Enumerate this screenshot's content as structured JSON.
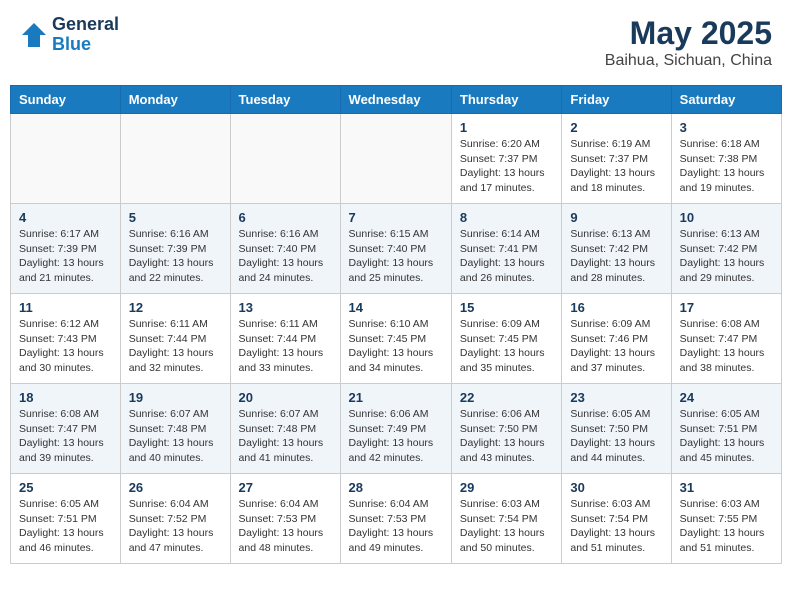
{
  "header": {
    "logo_line1": "General",
    "logo_line2": "Blue",
    "main_title": "May 2025",
    "subtitle": "Baihua, Sichuan, China"
  },
  "weekdays": [
    "Sunday",
    "Monday",
    "Tuesday",
    "Wednesday",
    "Thursday",
    "Friday",
    "Saturday"
  ],
  "weeks": [
    [
      {
        "day": "",
        "sunrise": "",
        "sunset": "",
        "daylight": ""
      },
      {
        "day": "",
        "sunrise": "",
        "sunset": "",
        "daylight": ""
      },
      {
        "day": "",
        "sunrise": "",
        "sunset": "",
        "daylight": ""
      },
      {
        "day": "",
        "sunrise": "",
        "sunset": "",
        "daylight": ""
      },
      {
        "day": "1",
        "sunrise": "Sunrise: 6:20 AM",
        "sunset": "Sunset: 7:37 PM",
        "daylight": "Daylight: 13 hours and 17 minutes."
      },
      {
        "day": "2",
        "sunrise": "Sunrise: 6:19 AM",
        "sunset": "Sunset: 7:37 PM",
        "daylight": "Daylight: 13 hours and 18 minutes."
      },
      {
        "day": "3",
        "sunrise": "Sunrise: 6:18 AM",
        "sunset": "Sunset: 7:38 PM",
        "daylight": "Daylight: 13 hours and 19 minutes."
      }
    ],
    [
      {
        "day": "4",
        "sunrise": "Sunrise: 6:17 AM",
        "sunset": "Sunset: 7:39 PM",
        "daylight": "Daylight: 13 hours and 21 minutes."
      },
      {
        "day": "5",
        "sunrise": "Sunrise: 6:16 AM",
        "sunset": "Sunset: 7:39 PM",
        "daylight": "Daylight: 13 hours and 22 minutes."
      },
      {
        "day": "6",
        "sunrise": "Sunrise: 6:16 AM",
        "sunset": "Sunset: 7:40 PM",
        "daylight": "Daylight: 13 hours and 24 minutes."
      },
      {
        "day": "7",
        "sunrise": "Sunrise: 6:15 AM",
        "sunset": "Sunset: 7:40 PM",
        "daylight": "Daylight: 13 hours and 25 minutes."
      },
      {
        "day": "8",
        "sunrise": "Sunrise: 6:14 AM",
        "sunset": "Sunset: 7:41 PM",
        "daylight": "Daylight: 13 hours and 26 minutes."
      },
      {
        "day": "9",
        "sunrise": "Sunrise: 6:13 AM",
        "sunset": "Sunset: 7:42 PM",
        "daylight": "Daylight: 13 hours and 28 minutes."
      },
      {
        "day": "10",
        "sunrise": "Sunrise: 6:13 AM",
        "sunset": "Sunset: 7:42 PM",
        "daylight": "Daylight: 13 hours and 29 minutes."
      }
    ],
    [
      {
        "day": "11",
        "sunrise": "Sunrise: 6:12 AM",
        "sunset": "Sunset: 7:43 PM",
        "daylight": "Daylight: 13 hours and 30 minutes."
      },
      {
        "day": "12",
        "sunrise": "Sunrise: 6:11 AM",
        "sunset": "Sunset: 7:44 PM",
        "daylight": "Daylight: 13 hours and 32 minutes."
      },
      {
        "day": "13",
        "sunrise": "Sunrise: 6:11 AM",
        "sunset": "Sunset: 7:44 PM",
        "daylight": "Daylight: 13 hours and 33 minutes."
      },
      {
        "day": "14",
        "sunrise": "Sunrise: 6:10 AM",
        "sunset": "Sunset: 7:45 PM",
        "daylight": "Daylight: 13 hours and 34 minutes."
      },
      {
        "day": "15",
        "sunrise": "Sunrise: 6:09 AM",
        "sunset": "Sunset: 7:45 PM",
        "daylight": "Daylight: 13 hours and 35 minutes."
      },
      {
        "day": "16",
        "sunrise": "Sunrise: 6:09 AM",
        "sunset": "Sunset: 7:46 PM",
        "daylight": "Daylight: 13 hours and 37 minutes."
      },
      {
        "day": "17",
        "sunrise": "Sunrise: 6:08 AM",
        "sunset": "Sunset: 7:47 PM",
        "daylight": "Daylight: 13 hours and 38 minutes."
      }
    ],
    [
      {
        "day": "18",
        "sunrise": "Sunrise: 6:08 AM",
        "sunset": "Sunset: 7:47 PM",
        "daylight": "Daylight: 13 hours and 39 minutes."
      },
      {
        "day": "19",
        "sunrise": "Sunrise: 6:07 AM",
        "sunset": "Sunset: 7:48 PM",
        "daylight": "Daylight: 13 hours and 40 minutes."
      },
      {
        "day": "20",
        "sunrise": "Sunrise: 6:07 AM",
        "sunset": "Sunset: 7:48 PM",
        "daylight": "Daylight: 13 hours and 41 minutes."
      },
      {
        "day": "21",
        "sunrise": "Sunrise: 6:06 AM",
        "sunset": "Sunset: 7:49 PM",
        "daylight": "Daylight: 13 hours and 42 minutes."
      },
      {
        "day": "22",
        "sunrise": "Sunrise: 6:06 AM",
        "sunset": "Sunset: 7:50 PM",
        "daylight": "Daylight: 13 hours and 43 minutes."
      },
      {
        "day": "23",
        "sunrise": "Sunrise: 6:05 AM",
        "sunset": "Sunset: 7:50 PM",
        "daylight": "Daylight: 13 hours and 44 minutes."
      },
      {
        "day": "24",
        "sunrise": "Sunrise: 6:05 AM",
        "sunset": "Sunset: 7:51 PM",
        "daylight": "Daylight: 13 hours and 45 minutes."
      }
    ],
    [
      {
        "day": "25",
        "sunrise": "Sunrise: 6:05 AM",
        "sunset": "Sunset: 7:51 PM",
        "daylight": "Daylight: 13 hours and 46 minutes."
      },
      {
        "day": "26",
        "sunrise": "Sunrise: 6:04 AM",
        "sunset": "Sunset: 7:52 PM",
        "daylight": "Daylight: 13 hours and 47 minutes."
      },
      {
        "day": "27",
        "sunrise": "Sunrise: 6:04 AM",
        "sunset": "Sunset: 7:53 PM",
        "daylight": "Daylight: 13 hours and 48 minutes."
      },
      {
        "day": "28",
        "sunrise": "Sunrise: 6:04 AM",
        "sunset": "Sunset: 7:53 PM",
        "daylight": "Daylight: 13 hours and 49 minutes."
      },
      {
        "day": "29",
        "sunrise": "Sunrise: 6:03 AM",
        "sunset": "Sunset: 7:54 PM",
        "daylight": "Daylight: 13 hours and 50 minutes."
      },
      {
        "day": "30",
        "sunrise": "Sunrise: 6:03 AM",
        "sunset": "Sunset: 7:54 PM",
        "daylight": "Daylight: 13 hours and 51 minutes."
      },
      {
        "day": "31",
        "sunrise": "Sunrise: 6:03 AM",
        "sunset": "Sunset: 7:55 PM",
        "daylight": "Daylight: 13 hours and 51 minutes."
      }
    ]
  ]
}
